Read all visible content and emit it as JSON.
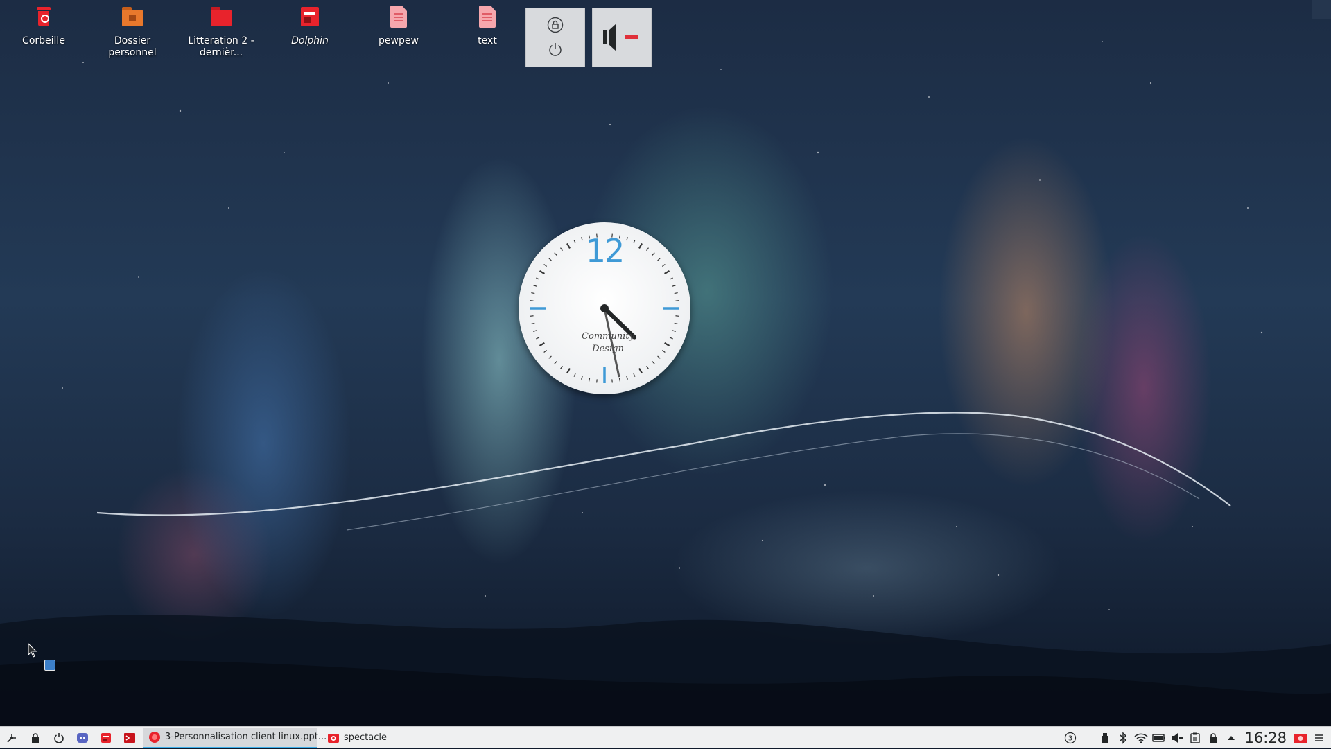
{
  "desktop": {
    "icons": [
      {
        "label": "Corbeille",
        "icon": "trash-icon"
      },
      {
        "label": "Dossier personnel",
        "icon": "home-folder-icon"
      },
      {
        "label": "Litteration 2 -\ndernièr...",
        "icon": "folder-icon"
      },
      {
        "label": "Dolphin",
        "icon": "dolphin-launcher-icon"
      },
      {
        "label": "pewpew",
        "icon": "text-file-icon"
      },
      {
        "label": "text",
        "icon": "text-file-icon"
      }
    ]
  },
  "widgets": {
    "session": {
      "lock": "lock-icon",
      "logout": "power-icon"
    },
    "audio": {
      "icon": "volume-muted-icon",
      "accent": "#e0303a"
    }
  },
  "clock_widget": {
    "twelve": "12",
    "brand": "Community\nDesign",
    "hour_hand": 4,
    "minute_hand": 28,
    "accent": "#3f9ad6"
  },
  "taskbar": {
    "launchers": [
      "application-menu-icon",
      "lock-screen-icon",
      "shutdown-icon",
      "discord-icon",
      "files-icon",
      "terminal-icon"
    ],
    "tasks": [
      {
        "label": "3-Personnalisation client linux.ppt...",
        "icon": "presentation-app-icon",
        "active": true
      },
      {
        "label": "spectacle",
        "icon": "screenshot-app-icon",
        "active": false
      }
    ],
    "tray": [
      "notification-badge-icon",
      "usb-icon",
      "bluetooth-icon",
      "wifi-icon",
      "battery-icon",
      "volume-icon",
      "clipboard-icon",
      "lock-icon",
      "expand-arrow-icon"
    ],
    "notification_count": "3",
    "time": "16:28",
    "accent": "#3daee9"
  }
}
